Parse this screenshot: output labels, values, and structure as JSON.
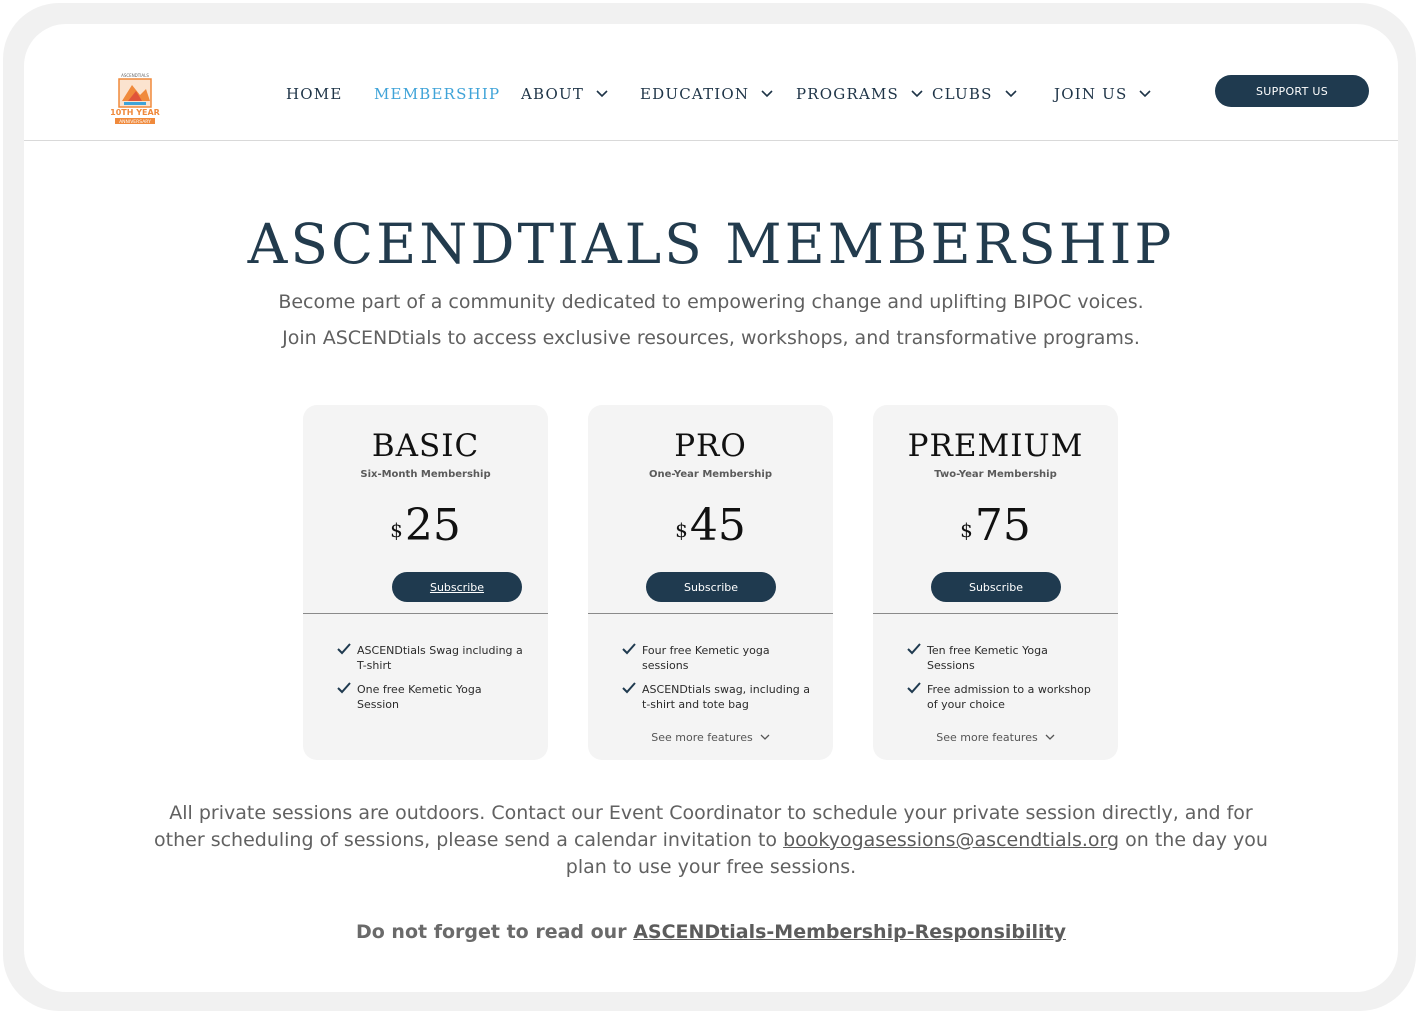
{
  "header": {
    "logo": {
      "text_top": "ASCENDTIALS",
      "text_anniv": "10TH YEAR",
      "text_sub": "ANNIVERSARY"
    },
    "nav": [
      {
        "label": "HOME",
        "dropdown": false,
        "active": false
      },
      {
        "label": "MEMBERSHIP",
        "dropdown": false,
        "active": true
      },
      {
        "label": "ABOUT",
        "dropdown": true,
        "active": false
      },
      {
        "label": "EDUCATION",
        "dropdown": true,
        "active": false
      },
      {
        "label": "PROGRAMS",
        "dropdown": true,
        "active": false
      },
      {
        "label": "CLUBS",
        "dropdown": true,
        "active": false
      },
      {
        "label": "JOIN US",
        "dropdown": true,
        "active": false
      }
    ],
    "support_label": "SUPPORT US"
  },
  "hero": {
    "title": "ASCENDTIALS MEMBERSHIP",
    "line1": "Become part of a community dedicated to empowering change and uplifting BIPOC voices.",
    "line2": "Join ASCENDtials to access exclusive resources, workshops, and transformative programs."
  },
  "plans": [
    {
      "name": "BASIC",
      "term": "Six-Month Membership",
      "currency": "$",
      "price": "25",
      "subscribe_label": "Subscribe",
      "features": [
        "ASCENDtials Swag including a T-shirt",
        "One free Kemetic Yoga Session"
      ],
      "see_more": ""
    },
    {
      "name": "PRO",
      "term": "One-Year Membership",
      "currency": "$",
      "price": "45",
      "subscribe_label": "Subscribe",
      "features": [
        "Four free Kemetic yoga sessions",
        "ASCENDtials swag, including a t-shirt and tote bag"
      ],
      "see_more": "See more features"
    },
    {
      "name": "PREMIUM",
      "term": "Two-Year Membership",
      "currency": "$",
      "price": "75",
      "subscribe_label": "Subscribe",
      "features": [
        "Ten free Kemetic Yoga Sessions",
        "Free admission to a workshop of your choice"
      ],
      "see_more": "See more features"
    }
  ],
  "note": {
    "text_before": "All private sessions are outdoors. Contact our Event Coordinator to schedule your private session directly, and for other scheduling of sessions, please send a calendar invitation to ",
    "email": "bookyogasessions@ascendtials.org",
    "text_after": " on the day you plan to use your free sessions."
  },
  "reminder": {
    "text": "Do not forget to read our ",
    "link": "ASCENDtials-Membership-Responsibility "
  },
  "colors": {
    "navy": "#1f3a4f",
    "accent_blue": "#3fa3d8",
    "card_bg": "#f4f4f4",
    "logo_orange": "#f08a3c"
  }
}
